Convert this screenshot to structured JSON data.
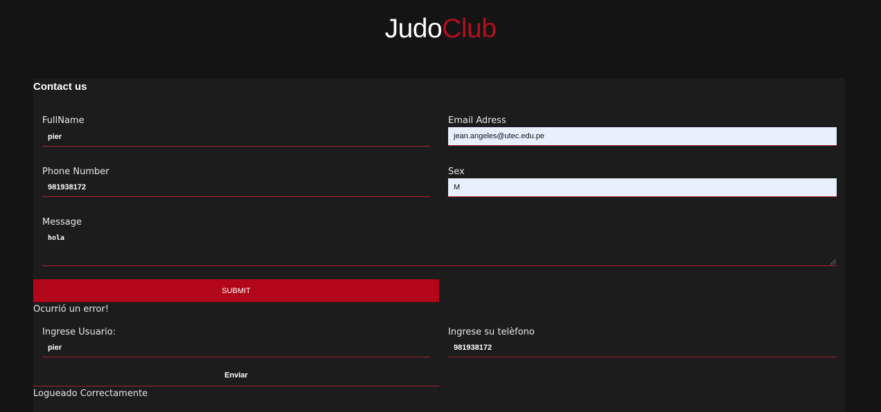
{
  "brand": {
    "part1": "Judo",
    "part2": "Club"
  },
  "contact": {
    "title": "Contact us",
    "fullname_label": "FullName",
    "fullname_value": "pier",
    "email_label": "Email Adress",
    "email_value": "jean.angeles@utec.edu.pe",
    "phone_label": "Phone Number",
    "phone_value": "981938172",
    "sex_label": "Sex",
    "sex_value": "M",
    "message_label": "Message",
    "message_value": "hola",
    "submit_label": "SUBMIT",
    "error_text": "Ocurrió un error!"
  },
  "login": {
    "user_label": "Ingrese Usuario:",
    "user_value": "pier",
    "phone_label": "Ingrese su telèfono",
    "phone_value": "981938172",
    "send_label": "Enviar",
    "success_text": "Logueado Correctamente"
  },
  "colors": {
    "accent": "#b10718",
    "background": "#141414",
    "panel": "#1c1c1d",
    "autofill": "#e8f0fe"
  }
}
